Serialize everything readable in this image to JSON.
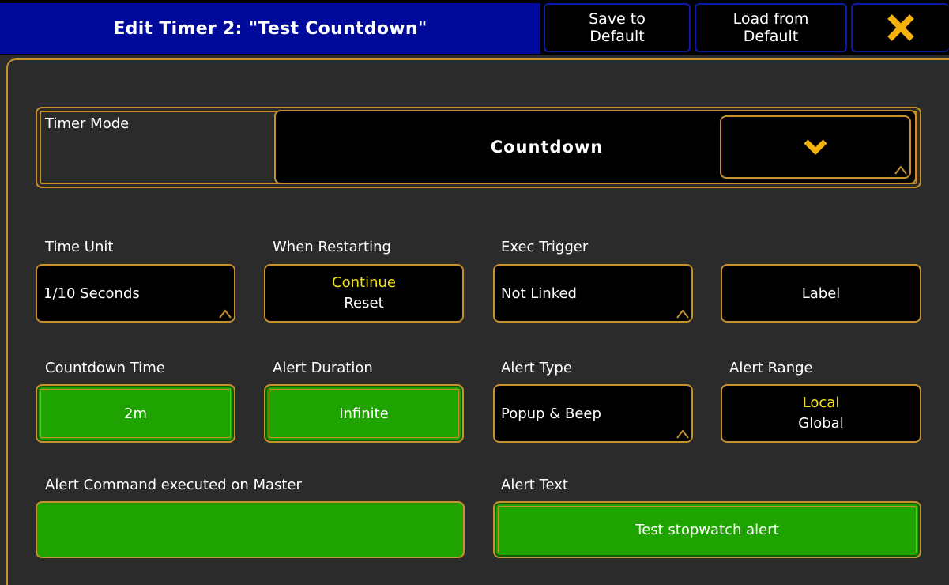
{
  "header": {
    "title": "Edit Timer 2: \"Test Countdown\"",
    "save_line1": "Save to",
    "save_line2": "Default",
    "load_line1": "Load from",
    "load_line2": "Default",
    "close_icon": "close-x-icon"
  },
  "timer_mode": {
    "label": "Timer Mode",
    "value": "Countdown",
    "dropdown_icon": "chevron-down-icon"
  },
  "time_unit": {
    "label": "Time Unit",
    "value": "1/10 Seconds"
  },
  "when_restarting": {
    "label": "When Restarting",
    "selected": "Continue",
    "other": "Reset"
  },
  "exec_trigger": {
    "label": "Exec Trigger",
    "value": "Not Linked"
  },
  "label_button": {
    "value": "Label"
  },
  "countdown_time": {
    "label": "Countdown Time",
    "value": "2m"
  },
  "alert_duration": {
    "label": "Alert Duration",
    "value": "Infinite"
  },
  "alert_type": {
    "label": "Alert Type",
    "value": "Popup & Beep"
  },
  "alert_range": {
    "label": "Alert Range",
    "selected": "Local",
    "other": "Global"
  },
  "alert_command": {
    "label": "Alert Command executed on Master",
    "value": ""
  },
  "alert_text": {
    "label": "Alert Text",
    "value": "Test stopwatch alert"
  },
  "colors": {
    "title_bar": "#000a9a",
    "accent_border": "#c6902a",
    "panel_bg": "#2b2b2b",
    "active_green": "#1fa300",
    "selected_text": "#f4e11a"
  }
}
